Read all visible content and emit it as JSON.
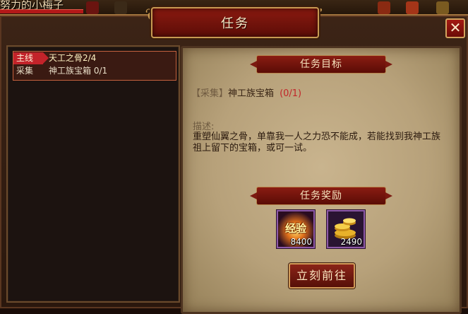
{
  "hud": {
    "player_name": "努力的小梅子"
  },
  "dialog": {
    "title": "任务",
    "close_label": "✕"
  },
  "task_list": {
    "main_tag": "主线",
    "main_title": "天工之骨2/4",
    "sub_label": "采集",
    "sub_title": "神工族宝箱 0/1"
  },
  "detail": {
    "objective_header": "任务目标",
    "objective_bracket_open": "【",
    "objective_type": "采集",
    "objective_bracket_close": "】",
    "objective_name": "神工族宝箱",
    "objective_progress": "(0/1)",
    "desc_label": "描述:",
    "desc_text": "重塑仙翼之骨，单靠我一人之力恐不能成，若能找到我神工族祖上留下的宝箱，或可一试。",
    "reward_header": "任务奖励",
    "rewards": [
      {
        "icon": "exp-icon",
        "icon_text": "经验",
        "count": "8400"
      },
      {
        "icon": "gold-coins-icon",
        "count": "2490"
      }
    ],
    "go_button": "立刻前往"
  },
  "colors": {
    "accent_red": "#c2232a",
    "frame_gold": "#c89a52",
    "parchment": "#c9b48e",
    "progress_red": "#c2262a"
  }
}
